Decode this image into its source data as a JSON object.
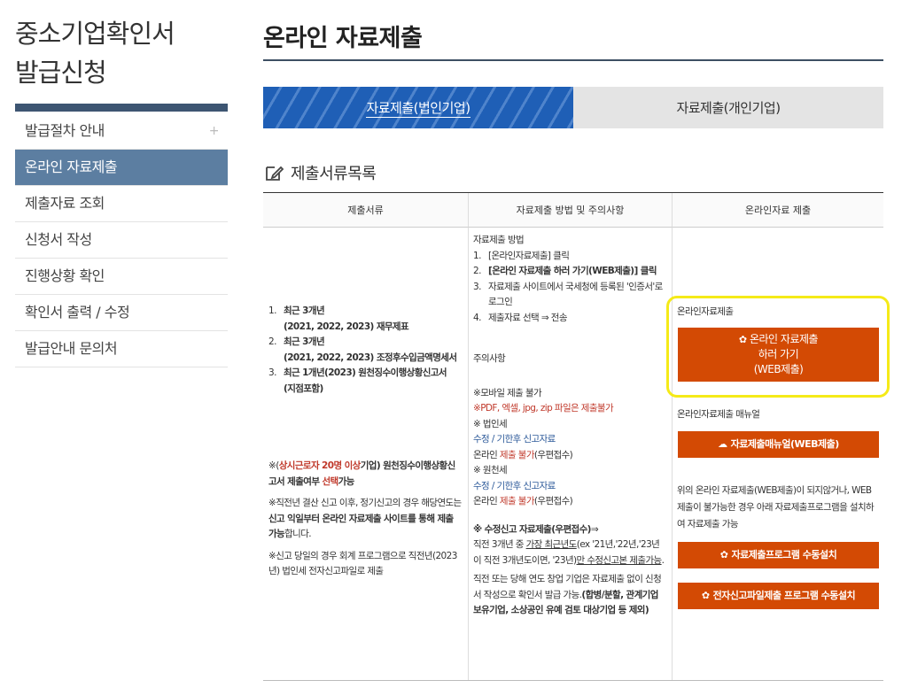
{
  "sidebar": {
    "title_line1": "중소기업확인서",
    "title_line2": "발급신청",
    "plus": "+",
    "items": [
      {
        "label": "발급절차 안내"
      },
      {
        "label": "온라인 자료제출"
      },
      {
        "label": "제출자료 조회"
      },
      {
        "label": "신청서 작성"
      },
      {
        "label": "진행상황 확인"
      },
      {
        "label": "확인서 출력 / 수정"
      },
      {
        "label": "발급안내 문의처"
      }
    ]
  },
  "main": {
    "title": "온라인 자료제출",
    "tabs": [
      {
        "label": "자료제출(법인기업)"
      },
      {
        "label": "자료제출(개인기업)"
      }
    ],
    "section_title": "제출서류목록",
    "table": {
      "headers": [
        "제출서류",
        "자료제출 방법 및 주의사항",
        "온라인자료 제출"
      ],
      "col1": {
        "docs": [
          {
            "n": "1.",
            "line1": "최근 3개년",
            "line2": "(2021, 2022, 2023) 재무제표"
          },
          {
            "n": "2.",
            "line1": "최근 3개년",
            "line2": "(2021, 2022, 2023) 조정후수입금액명세서"
          },
          {
            "n": "3.",
            "line1": "최근 1개년(2023) 원천징수이행상황신고서",
            "line2": "(지점포함)"
          }
        ],
        "note1": {
          "prefix": "※(",
          "red": "상시근로자 20명 이상",
          "mid": "기업) 원천징수이행상황신고서 제출여부 ",
          "red2": "선택",
          "suffix": "가능"
        },
        "note2": {
          "pre": "※직전년 결산 신고 이후, 정기신고의 경우 해당연도는 ",
          "bold": "신고 익일부터 온라인 자료제출 사이트를 통해 제출 가능",
          "suf": "합니다."
        },
        "note3": "※신고 당일의 경우 회계 프로그램으로 직전년(2023년) 법인세 전자신고파일로 제출"
      },
      "col2": {
        "method_title": "자료제출 방법",
        "steps": [
          {
            "n": "1.",
            "text": "[온라인자료제출] 클릭"
          },
          {
            "n": "2.",
            "text": "[온라인 자료제출 하러 가기(WEB제출)] 클릭"
          },
          {
            "n": "3.",
            "text": "자료제출 사이트에서 국세청에 등록된 '인증서'로 로그인"
          },
          {
            "n": "4.",
            "text": "제출자료 선택 ⇒ 전송"
          }
        ],
        "caution_title": "주의사항",
        "mobile": "※모바일 제출 불가",
        "formats": "※PDF, 엑셀, jpg, zip 파일은 제출불가",
        "corp_tax": "※ 법인세",
        "corp_amend": "수정 / 기한후 신고자료",
        "corp_online_pre": "온라인 ",
        "corp_online_red": "제출 불가",
        "corp_online_suf": "(우편접수)",
        "withholding": "※ 원천세",
        "wh_amend": "수정 / 기한후 신고자료",
        "wh_online_pre": "온라인 ",
        "wh_online_red": "제출 불가",
        "wh_online_suf": "(우편접수)",
        "amend_title": "※ 수정신고 자료제출(우편접수)",
        "amend_arrow": "⇒",
        "amend_pre": "직전 3개년 중 ",
        "amend_u1": "가장 최근년도",
        "amend_mid": "(ex '21년,'22년,'23년이 직전 3개년도이면, '23년)",
        "amend_u2": "만 수정신고본 제출가능",
        "amend_suf": ".",
        "new_pre": "직전 또는 당해 연도 창업 기업은 자료제출 없이 신청서 작성으로 확인서 발급 가능.",
        "new_bold": "(합병/분할, 관계기업 보유기업, 소상공인 유예 검토 대상기업 등 제외)"
      },
      "col3": {
        "online_label": "온라인자료제출",
        "btn_web_line1": "온라인 자료제출",
        "btn_web_line2": "하러 가기",
        "btn_web_line3": "(WEB제출)",
        "manual_label": "온라인자료제출 매뉴얼",
        "btn_manual": "자료제출매뉴얼(WEB제출)",
        "program_note": "위의 온라인 자료제출(WEB제출)이 되지않거나, WEB 제출이 불가능한 경우 아래 자료제출프로그램을 설치하여 자료제출 가능",
        "btn_program": "자료제출프로그램 수동설치",
        "btn_efile": "전자신고파일제출 프로그램 수동설치"
      }
    }
  },
  "colors": {
    "accent_blue": "#1f5fb6",
    "sidebar_active": "#5c7ea1",
    "button_orange": "#d34a04",
    "highlight_yellow": "#f5ea18"
  },
  "icons": {
    "section": "pencil-square-icon",
    "web_btn": "gear-icon",
    "manual_btn": "cloud-download-icon",
    "program_btn": "gear-icon",
    "efile_btn": "gear-icon"
  }
}
